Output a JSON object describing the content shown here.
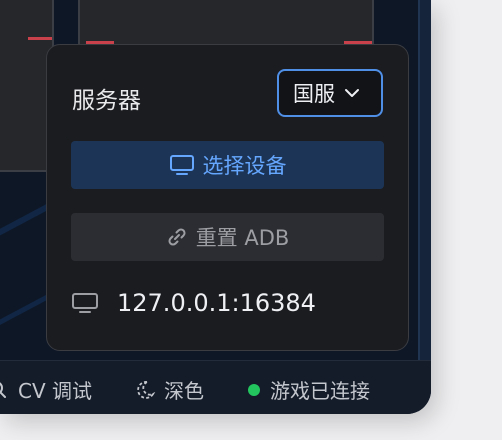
{
  "popup": {
    "server_label": "服务器",
    "server_value": "国服",
    "select_device_label": "选择设备",
    "reset_adb_label": "重置 ADB",
    "device_address": "127.0.0.1:16384"
  },
  "status_bar": {
    "cv_debug_label": "CV 调试",
    "theme_label": "深色",
    "connection_label": "游戏已连接"
  },
  "colors": {
    "accent": "#65a6ff",
    "select_border": "#4f8fe6",
    "connected": "#22c55e",
    "card_marker": "#c9414a"
  },
  "icons": {
    "server_chevron": "chevron-down-icon",
    "select_device": "monitor-icon",
    "reset_adb": "link-icon",
    "device": "monitor-icon",
    "cv_debug": "search-icon",
    "theme": "moon-icon"
  }
}
